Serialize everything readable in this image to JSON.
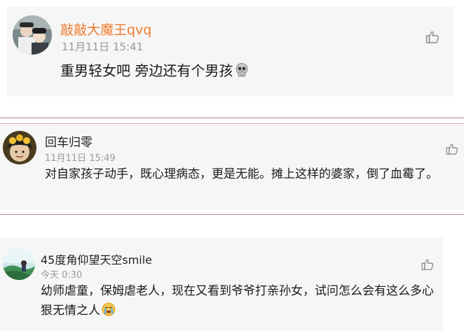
{
  "comments": [
    {
      "username": "敲敲大魔王qvq",
      "username_color": "#f07a2a",
      "timestamp": "11月11日 15:41",
      "text": "重男轻女吧 旁边还有个男孩",
      "emoji": "skull-emoji"
    },
    {
      "username": "回车归零",
      "username_color": "#222222",
      "timestamp": "11月11日 15:49",
      "text": "对自家孩子动手，既心理病态，更是无能。摊上这样的婆家，倒了血霉了。"
    },
    {
      "username": "45度角仰望天空smile",
      "username_color": "#222222",
      "timestamp": "今天 0:30",
      "text": "幼师虐童，保姆虐老人，现在又看到爷爷打亲孙女，试问怎么会有这么多心狠无情之人",
      "emoji": "crying-face-emoji"
    }
  ],
  "icons": {
    "like": "thumbs-up-icon"
  }
}
